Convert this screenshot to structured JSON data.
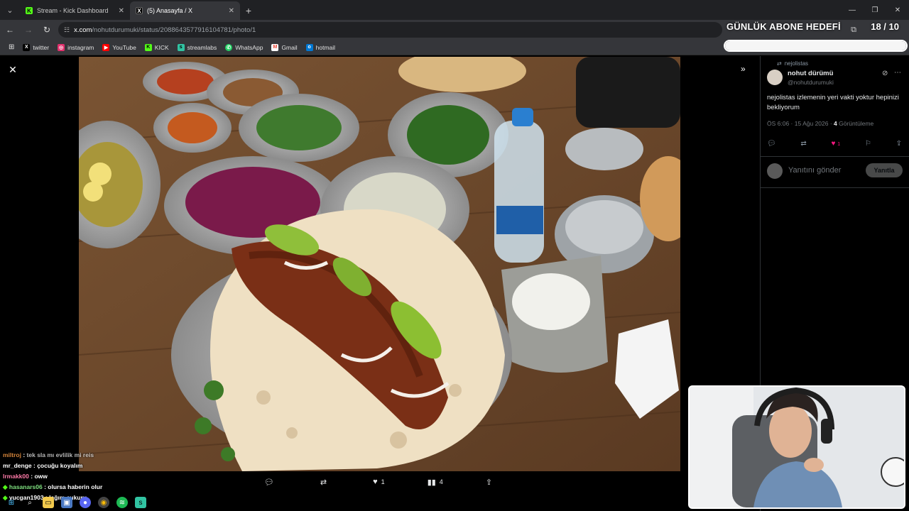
{
  "browser": {
    "tabs": [
      {
        "label": "Stream - Kick Dashboard",
        "favicon": "kick-icon",
        "active": false,
        "color": "#53fc18"
      },
      {
        "label": "(5) Anasayfa / X",
        "favicon": "x-icon",
        "active": true,
        "color": "#ffffff"
      }
    ],
    "url_host": "x.com",
    "url_path": "/nohutdurumuki/status/2088643577916104781/photo/1",
    "bookmarks": [
      {
        "label": "twitter",
        "icon": "x-icon",
        "color": "#ffffff"
      },
      {
        "label": "instagram",
        "icon": "instagram-icon",
        "color": "#e1306c"
      },
      {
        "label": "YouTube",
        "icon": "youtube-icon",
        "color": "#ff0000"
      },
      {
        "label": "KICK",
        "icon": "kick-icon",
        "color": "#53fc18"
      },
      {
        "label": "streamlabs",
        "icon": "streamlabs-icon",
        "color": "#31c3a2"
      },
      {
        "label": "WhatsApp",
        "icon": "whatsapp-icon",
        "color": "#25d366"
      },
      {
        "label": "Gmail",
        "icon": "gmail-icon",
        "color": "#ea4335"
      },
      {
        "label": "hotmail",
        "icon": "hotmail-icon",
        "color": "#0078d4"
      }
    ]
  },
  "stream_overlay": {
    "goal_title": "GÜNLÜK ABONE HEDEFİ",
    "goal_count": "18 / 10",
    "goal_progress": 1.0
  },
  "viewer": {
    "actions": [
      {
        "name": "reply",
        "icon": "reply-icon",
        "count": ""
      },
      {
        "name": "repost",
        "icon": "repost-icon",
        "count": ""
      },
      {
        "name": "like",
        "icon": "heart-icon",
        "count": "1"
      },
      {
        "name": "views",
        "icon": "views-icon",
        "count": "4"
      },
      {
        "name": "share",
        "icon": "share-icon",
        "count": ""
      }
    ]
  },
  "tweet": {
    "repost_note": "nejolistas",
    "author_name": "nohut dürümü",
    "author_handle": "@nohutdurumuki",
    "text": "nejolistas izlemenin yeri vakti yoktur hepinizi bekliyorum",
    "meta_time": "ÖS 6:06 · 15 Ağu 2026 · ",
    "meta_views": "4",
    "meta_views_label": " Görüntüleme",
    "like_count": "1",
    "reply_placeholder": "Yanıtını gönder",
    "reply_button": "Yanıtla"
  },
  "chat": [
    {
      "user": "miltroj",
      "message": "tek sla mı evlilik mi reis",
      "color": "#d4843a"
    },
    {
      "user": "mr_denge",
      "message": "çocuğu koyalım",
      "color": "#ffffff"
    },
    {
      "user": "lrmakk00",
      "message": "oww",
      "color": "#ff7aa8"
    },
    {
      "user": "hasanars06",
      "message": "olursa haberin olur",
      "color": "#7fe07f"
    },
    {
      "user": "yucgan1903",
      "message": "lağım çukuru",
      "color": "#ffffff"
    }
  ],
  "colors": {
    "accent_like": "#f91880",
    "panel_border": "#2f3336",
    "muted_text": "#71767b"
  }
}
